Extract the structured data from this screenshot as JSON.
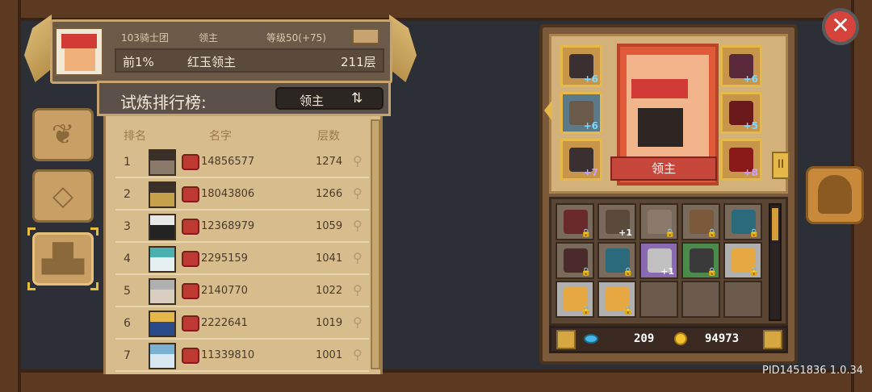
{
  "header": {
    "guild": "103骑士团",
    "role": "领主",
    "level": "等级50(+75)",
    "rank": "前1%",
    "title_name": "红玉领主",
    "floor": "211层"
  },
  "leaderboard": {
    "title": "试炼排行榜:",
    "filter_label": "领主",
    "filter_icon": "swap-icon",
    "columns": {
      "rank": "排名",
      "name": "名字",
      "floor": "层数"
    },
    "rows": [
      {
        "rank": "1",
        "name": "14856577",
        "floor": "1274"
      },
      {
        "rank": "2",
        "name": "18043806",
        "floor": "1266"
      },
      {
        "rank": "3",
        "name": "12368979",
        "floor": "1059"
      },
      {
        "rank": "4",
        "name": "2295159",
        "floor": "1041"
      },
      {
        "rank": "5",
        "name": "2140770",
        "floor": "1022"
      },
      {
        "rank": "6",
        "name": "2222641",
        "floor": "1019"
      },
      {
        "rank": "7",
        "name": "11339810",
        "floor": "1001"
      }
    ]
  },
  "equipment": {
    "character_label": "领主",
    "slots_left": [
      {
        "icon": "ring-icon",
        "plus": "+6"
      },
      {
        "icon": "amulet-icon",
        "plus": "+6"
      },
      {
        "icon": "gloves-icon",
        "plus": "+7"
      }
    ],
    "slots_right": [
      {
        "icon": "helmet-icon",
        "plus": "+6"
      },
      {
        "icon": "armor-icon",
        "plus": "+5"
      },
      {
        "icon": "sword-icon",
        "plus": "+8"
      }
    ],
    "gold_tab": "II"
  },
  "inventory": [
    {
      "icon": "sword-icon",
      "badge": "lock"
    },
    {
      "icon": "crossbow-icon",
      "badge": "+1"
    },
    {
      "icon": "helmet-icon",
      "badge": "lock"
    },
    {
      "icon": "boots-icon",
      "badge": "lock"
    },
    {
      "icon": "ring-icon",
      "badge": "lock"
    },
    {
      "icon": "amulet-icon",
      "badge": "lock"
    },
    {
      "icon": "ring-icon",
      "badge": "lock"
    },
    {
      "icon": "axe-icon",
      "badge": "+1"
    },
    {
      "icon": "shield-icon",
      "badge": "lock"
    },
    {
      "icon": "scroll-icon",
      "badge": "lock"
    },
    {
      "icon": "scroll-icon",
      "badge": "lock"
    },
    {
      "icon": "scroll-icon",
      "badge": "lock"
    },
    {
      "icon": "",
      "badge": ""
    },
    {
      "icon": "",
      "badge": ""
    },
    {
      "icon": "",
      "badge": ""
    }
  ],
  "currency": {
    "gems": "209",
    "gold": "94973"
  },
  "version": "PID1451836 1.0.34"
}
